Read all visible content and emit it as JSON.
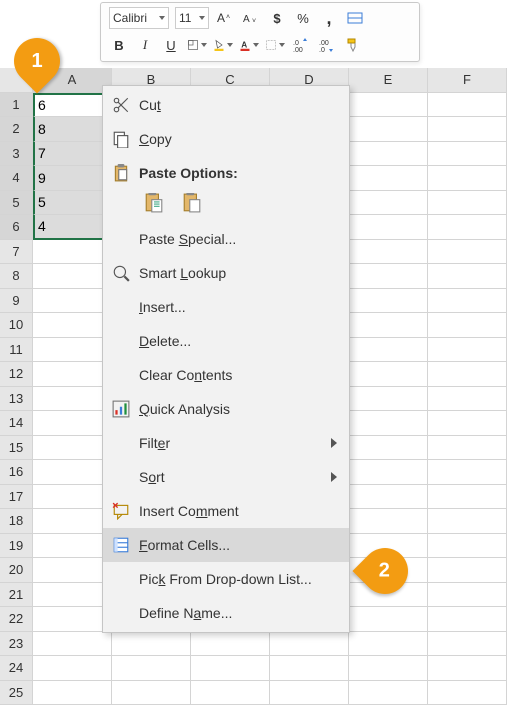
{
  "toolbar": {
    "font_name": "Calibri",
    "font_size": "11"
  },
  "columns": [
    "A",
    "B",
    "C",
    "D",
    "E",
    "F"
  ],
  "rows": [
    "1",
    "2",
    "3",
    "4",
    "5",
    "6",
    "7",
    "8",
    "9",
    "10",
    "11",
    "12",
    "13",
    "14",
    "15",
    "16",
    "17",
    "18",
    "19",
    "20",
    "21",
    "22",
    "23",
    "24",
    "25"
  ],
  "cells": {
    "A1": "6",
    "A2": "8",
    "A3": "7",
    "A4": "9",
    "A5": "5",
    "A6": "4"
  },
  "selected_rows": [
    "1",
    "2",
    "3",
    "4",
    "5",
    "6"
  ],
  "context_menu": {
    "cut": "Cut",
    "copy": "Copy",
    "paste_options": "Paste Options:",
    "paste_special": "Paste Special...",
    "smart_lookup": "Smart Lookup",
    "insert": "Insert...",
    "delete": "Delete...",
    "clear_contents": "Clear Contents",
    "quick_analysis": "Quick Analysis",
    "filter": "Filter",
    "sort": "Sort",
    "insert_comment": "Insert Comment",
    "format_cells": "Format Cells...",
    "pick_from_list": "Pick From Drop-down List...",
    "define_name": "Define Name..."
  },
  "callouts": {
    "one": "1",
    "two": "2"
  }
}
